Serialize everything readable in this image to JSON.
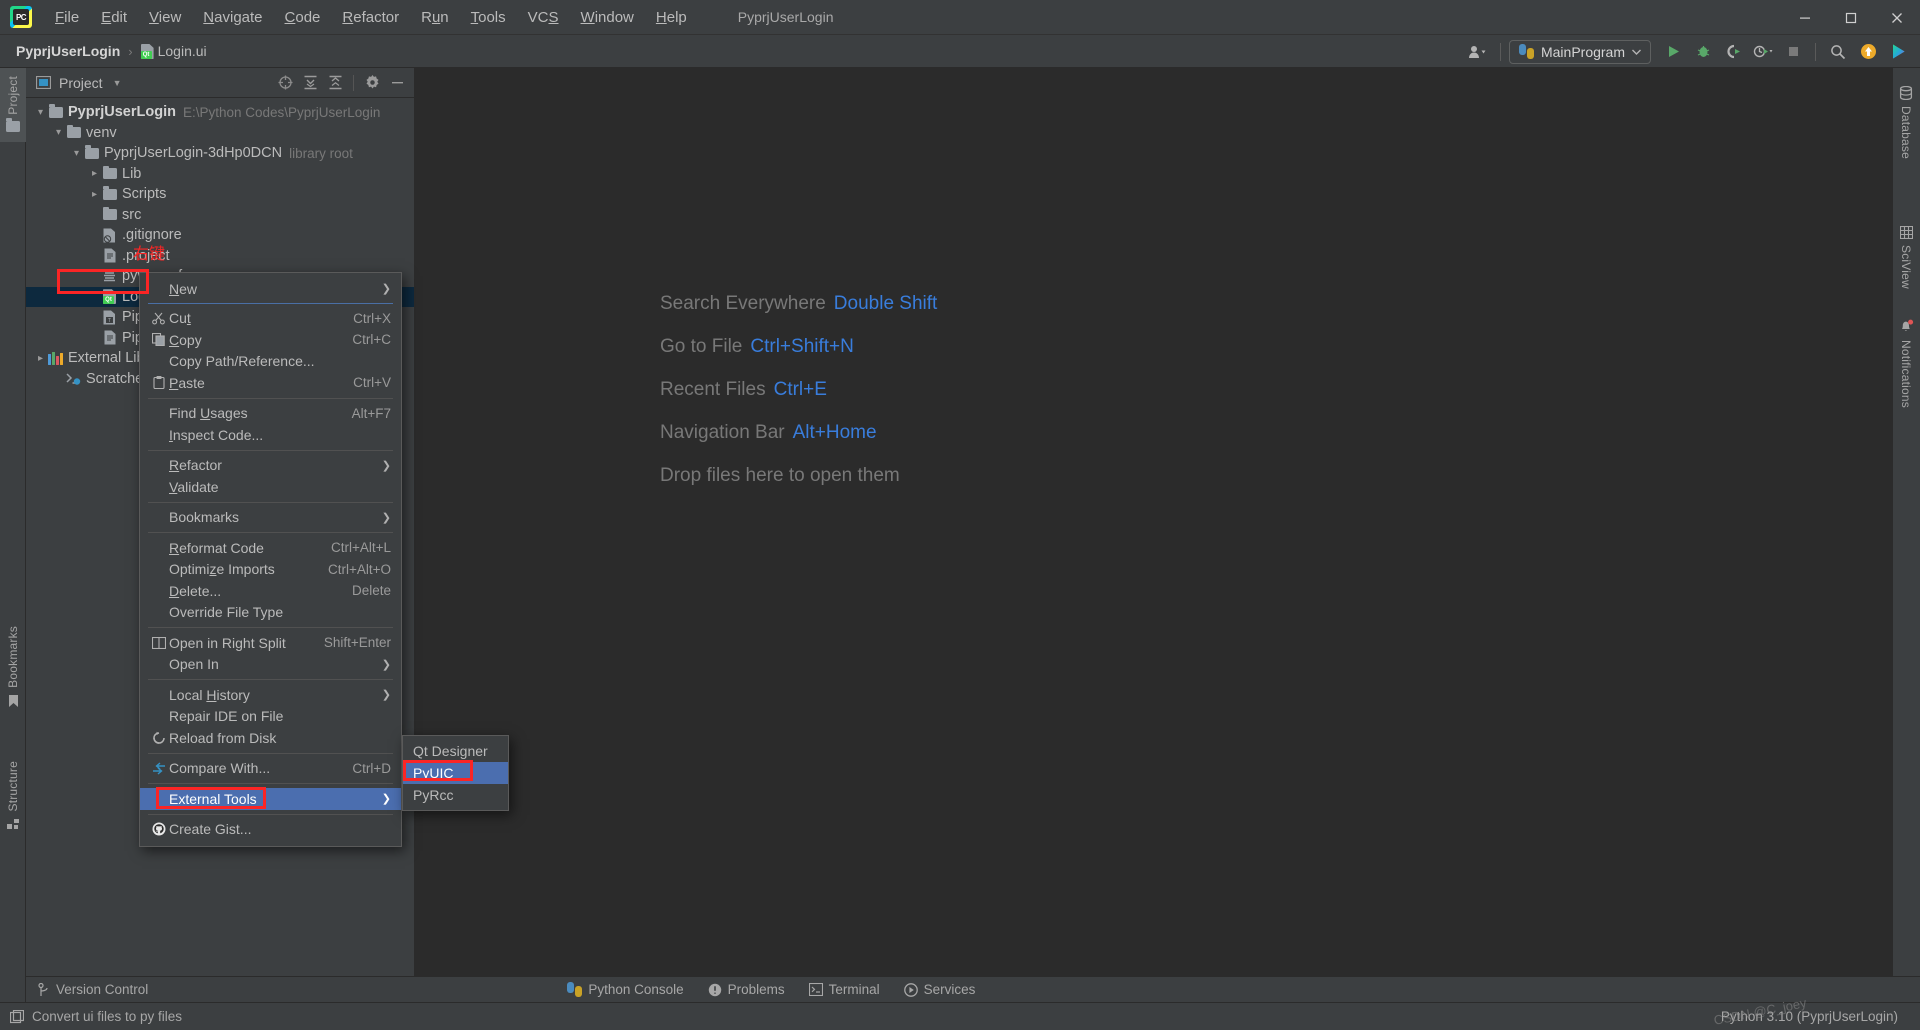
{
  "window": {
    "title": "PyprjUserLogin",
    "logo_label": "PC",
    "minimize": "minimize-icon",
    "maximize": "maximize-icon",
    "close": "close-icon"
  },
  "menubar": {
    "items": [
      {
        "label": "File",
        "mnemonic": "F"
      },
      {
        "label": "Edit",
        "mnemonic": "E"
      },
      {
        "label": "View",
        "mnemonic": "V"
      },
      {
        "label": "Navigate",
        "mnemonic": "N"
      },
      {
        "label": "Code",
        "mnemonic": "C"
      },
      {
        "label": "Refactor",
        "mnemonic": "R"
      },
      {
        "label": "Run",
        "mnemonic": "u"
      },
      {
        "label": "Tools",
        "mnemonic": "T"
      },
      {
        "label": "VCS",
        "mnemonic": "S"
      },
      {
        "label": "Window",
        "mnemonic": "W"
      },
      {
        "label": "Help",
        "mnemonic": "H"
      }
    ]
  },
  "breadcrumb": {
    "project": "PyprjUserLogin",
    "separator": "›",
    "file": "Login.ui"
  },
  "toolbar": {
    "account_icon": "user-account-icon",
    "run_config": "MainProgram",
    "run_icon": "run-icon",
    "debug_icon": "debug-icon",
    "coverage_icon": "run-with-coverage-icon",
    "profile_icon": "profile-icon",
    "stop_icon": "stop-icon",
    "search_icon": "search-icon",
    "update_icon": "update-project-icon",
    "ide_icon": "ide-features-trainer-icon"
  },
  "left_strip": {
    "tabs": [
      {
        "label": "Project",
        "icon": "project-folder-icon",
        "active": true
      },
      {
        "label": "Bookmarks",
        "icon": "bookmark-icon",
        "active": false
      },
      {
        "label": "Structure",
        "icon": "structure-icon",
        "active": false
      }
    ]
  },
  "right_strip": {
    "tabs": [
      {
        "label": "Database",
        "icon": "database-icon"
      },
      {
        "label": "SciView",
        "icon": "sciview-grid-icon"
      },
      {
        "label": "Notifications",
        "icon": "bell-icon",
        "badge": true
      }
    ]
  },
  "project_panel": {
    "title": "Project",
    "title_icon": "project-icon",
    "dropdown_icon": "chevron-down-icon",
    "actions": [
      {
        "name": "select-opened-file-icon"
      },
      {
        "name": "expand-all-icon"
      },
      {
        "name": "collapse-all-icon"
      },
      {
        "name": "settings-gear-icon"
      },
      {
        "name": "hide-panel-icon"
      }
    ],
    "tree": [
      {
        "label": "PyprjUserLogin",
        "sub": "E:\\Python Codes\\PyprjUserLogin",
        "indent": 0,
        "arrow": "expanded",
        "icon": "folder",
        "bold": true
      },
      {
        "label": "venv",
        "sub": "",
        "indent": 1,
        "arrow": "expanded",
        "icon": "folder",
        "bold": false
      },
      {
        "label": "PyprjUserLogin-3dHp0DCN",
        "sub": "library root",
        "indent": 2,
        "arrow": "expanded",
        "icon": "folder",
        "bold": false
      },
      {
        "label": "Lib",
        "sub": "",
        "indent": 3,
        "arrow": "collapsed",
        "icon": "folder",
        "bold": false
      },
      {
        "label": "Scripts",
        "sub": "",
        "indent": 3,
        "arrow": "collapsed",
        "icon": "folder",
        "bold": false
      },
      {
        "label": "src",
        "sub": "",
        "indent": 3,
        "arrow": "none",
        "icon": "folder",
        "bold": false
      },
      {
        "label": ".gitignore",
        "sub": "",
        "indent": 3,
        "arrow": "none",
        "icon": "gitignore-file",
        "bold": false
      },
      {
        "label": ".project",
        "sub": "",
        "indent": 3,
        "arrow": "none",
        "icon": "text-file",
        "bold": false
      },
      {
        "label": "pyvenv.cfg",
        "sub": "",
        "indent": 3,
        "arrow": "none",
        "icon": "config-file",
        "bold": false
      },
      {
        "label": "Login.ui",
        "sub": "",
        "indent": 3,
        "arrow": "none",
        "icon": "qt-ui-file",
        "bold": false,
        "selected": true
      },
      {
        "label": "Pipfile",
        "sub": "",
        "indent": 3,
        "arrow": "none",
        "icon": "pipfile",
        "bold": false
      },
      {
        "label": "Pipfile.lock",
        "sub": "",
        "indent": 3,
        "arrow": "none",
        "icon": "text-file",
        "bold": false
      },
      {
        "label": "External Libraries",
        "sub": "",
        "indent": 0,
        "arrow": "collapsed",
        "icon": "libraries",
        "bold": false
      },
      {
        "label": "Scratches and Consoles",
        "sub": "",
        "indent": 0,
        "arrow": "none",
        "icon": "scratches",
        "bold": false
      }
    ]
  },
  "editor": {
    "hints": [
      {
        "text": "Search Everywhere",
        "key": "Double Shift"
      },
      {
        "text": "Go to File",
        "key": "Ctrl+Shift+N"
      },
      {
        "text": "Recent Files",
        "key": "Ctrl+E"
      },
      {
        "text": "Navigation Bar",
        "key": "Alt+Home"
      },
      {
        "text": "Drop files here to open them",
        "key": ""
      }
    ]
  },
  "context_menu": {
    "items": [
      {
        "type": "item",
        "label": "New",
        "mnemonic": "N",
        "key": "",
        "arrow": true,
        "icon": ""
      },
      {
        "type": "sep_blue"
      },
      {
        "type": "item",
        "label": "Cut",
        "mnemonic": "t",
        "key": "Ctrl+X",
        "arrow": false,
        "icon": "scissors-icon"
      },
      {
        "type": "item",
        "label": "Copy",
        "mnemonic": "C",
        "key": "Ctrl+C",
        "arrow": false,
        "icon": "copy-icon"
      },
      {
        "type": "item",
        "label": "Copy Path/Reference...",
        "mnemonic": "",
        "key": "",
        "arrow": false,
        "icon": ""
      },
      {
        "type": "item",
        "label": "Paste",
        "mnemonic": "P",
        "key": "Ctrl+V",
        "arrow": false,
        "icon": "paste-icon"
      },
      {
        "type": "sep"
      },
      {
        "type": "item",
        "label": "Find Usages",
        "mnemonic": "U",
        "key": "Alt+F7",
        "arrow": false,
        "icon": ""
      },
      {
        "type": "item",
        "label": "Inspect Code...",
        "mnemonic": "I",
        "key": "",
        "arrow": false,
        "icon": ""
      },
      {
        "type": "sep"
      },
      {
        "type": "item",
        "label": "Refactor",
        "mnemonic": "R",
        "key": "",
        "arrow": true,
        "icon": ""
      },
      {
        "type": "item",
        "label": "Validate",
        "mnemonic": "V",
        "key": "",
        "arrow": false,
        "icon": ""
      },
      {
        "type": "sep"
      },
      {
        "type": "item",
        "label": "Bookmarks",
        "mnemonic": "",
        "key": "",
        "arrow": true,
        "icon": ""
      },
      {
        "type": "sep"
      },
      {
        "type": "item",
        "label": "Reformat Code",
        "mnemonic": "R",
        "key": "Ctrl+Alt+L",
        "arrow": false,
        "icon": ""
      },
      {
        "type": "item",
        "label": "Optimize Imports",
        "mnemonic": "z",
        "key": "Ctrl+Alt+O",
        "arrow": false,
        "icon": ""
      },
      {
        "type": "item",
        "label": "Delete...",
        "mnemonic": "D",
        "key": "Delete",
        "arrow": false,
        "icon": ""
      },
      {
        "type": "item",
        "label": "Override File Type",
        "mnemonic": "",
        "key": "",
        "arrow": false,
        "icon": ""
      },
      {
        "type": "sep"
      },
      {
        "type": "item",
        "label": "Open in Right Split",
        "mnemonic": "",
        "key": "Shift+Enter",
        "arrow": false,
        "icon": "split-icon"
      },
      {
        "type": "item",
        "label": "Open In",
        "mnemonic": "",
        "key": "",
        "arrow": true,
        "icon": ""
      },
      {
        "type": "sep"
      },
      {
        "type": "item",
        "label": "Local History",
        "mnemonic": "H",
        "key": "",
        "arrow": true,
        "icon": ""
      },
      {
        "type": "item",
        "label": "Repair IDE on File",
        "mnemonic": "",
        "key": "",
        "arrow": false,
        "icon": ""
      },
      {
        "type": "item",
        "label": "Reload from Disk",
        "mnemonic": "",
        "key": "",
        "arrow": false,
        "icon": "reload-icon"
      },
      {
        "type": "sep"
      },
      {
        "type": "item",
        "label": "Compare With...",
        "mnemonic": "",
        "key": "Ctrl+D",
        "arrow": false,
        "icon": "compare-icon"
      },
      {
        "type": "sep"
      },
      {
        "type": "item",
        "label": "External Tools",
        "mnemonic": "",
        "key": "",
        "arrow": true,
        "icon": "",
        "highlighted": true
      },
      {
        "type": "sep"
      },
      {
        "type": "item",
        "label": "Create Gist...",
        "mnemonic": "",
        "key": "",
        "arrow": false,
        "icon": "github-icon"
      }
    ]
  },
  "submenu": {
    "items": [
      {
        "label": "Qt Designer",
        "highlighted": false
      },
      {
        "label": "PyUIC",
        "highlighted": true
      },
      {
        "label": "PyRcc",
        "highlighted": false
      }
    ]
  },
  "tool_windows": {
    "items": [
      {
        "label": "Version Control",
        "icon": "branch-icon"
      },
      {
        "label": "Python Console",
        "icon": "python-console-icon"
      },
      {
        "label": "Problems",
        "icon": "problems-icon"
      },
      {
        "label": "Terminal",
        "icon": "terminal-icon"
      },
      {
        "label": "Services",
        "icon": "services-icon"
      }
    ]
  },
  "status_bar": {
    "left_text": "Convert ui files to py files",
    "left_icon": "external-tool-icon",
    "interpreter": "Python 3.10 (PyprjUserLogin)"
  },
  "annotations": {
    "right_click_label": "右键",
    "watermark": "CSDN @C_joey",
    "accent_red": "#fb2525",
    "highlight_blue": "#4b6eaf"
  }
}
